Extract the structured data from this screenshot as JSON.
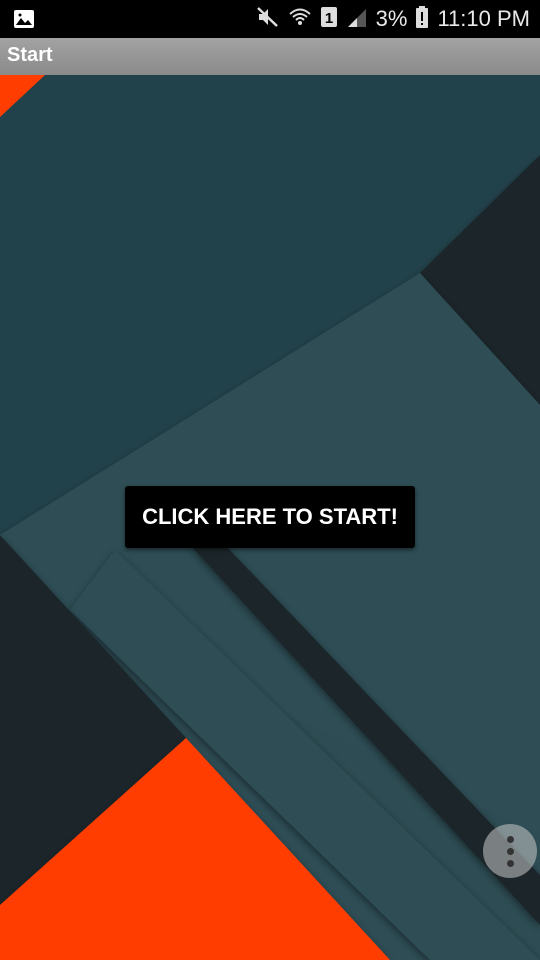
{
  "status_bar": {
    "battery_text": "3%",
    "time": "11:10 PM",
    "icons": [
      "gallery-icon",
      "mute-icon",
      "wifi-icon",
      "sim-1-icon",
      "signal-icon",
      "battery-alert-icon"
    ]
  },
  "app_bar": {
    "title": "Start"
  },
  "main": {
    "start_button_label": "CLICK HERE TO START!"
  },
  "overflow": {
    "icon": "more-vert-icon"
  },
  "colors": {
    "dark_teal": "#22424b",
    "mid_teal": "#2d4d54",
    "darkest": "#1b262c",
    "orange": "#ff3d00"
  }
}
